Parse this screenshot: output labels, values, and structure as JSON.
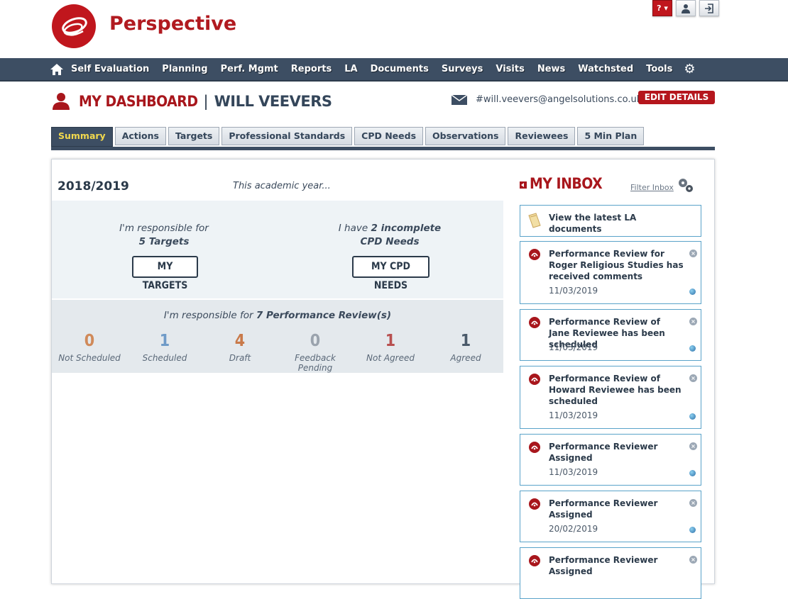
{
  "app": {
    "name": "Perspective"
  },
  "top_buttons": {
    "help": "? ▾",
    "user": "user",
    "logout": "logout"
  },
  "nav": {
    "items": [
      "Self Evaluation",
      "Planning",
      "Perf. Mgmt",
      "Reports",
      "LA",
      "Documents",
      "Surveys",
      "Visits",
      "News",
      "Watchsted",
      "Tools"
    ]
  },
  "header": {
    "title_a": "MY DASHBOARD",
    "separator": "|",
    "title_b": "WILL VEEVERS",
    "email": "#will.veevers@angelsolutions.co.uk",
    "edit_label": "EDIT DETAILS"
  },
  "tabs": [
    "Summary",
    "Actions",
    "Targets",
    "Professional Standards",
    "CPD Needs",
    "Observations",
    "Reviewees",
    "5 Min Plan"
  ],
  "summary": {
    "year": "2018/2019",
    "academic_label": "This academic year...",
    "targets_line1": "I'm responsible for",
    "targets_line2": "5 Targets",
    "targets_button": "MY TARGETS",
    "cpd_line1_a": "I have ",
    "cpd_line1_b": "2 incomplete",
    "cpd_line2": "CPD Needs",
    "cpd_button": "MY CPD NEEDS",
    "pr_head_a": "I'm responsible for ",
    "pr_head_b": "7 Performance Review(s)",
    "stats": [
      {
        "value": "0",
        "label": "Not Scheduled",
        "color": "#d08a5a"
      },
      {
        "value": "1",
        "label": "Scheduled",
        "color": "#6f9bc8"
      },
      {
        "value": "4",
        "label": "Draft",
        "color": "#c97a4a"
      },
      {
        "value": "0",
        "label": "Feedback Pending",
        "color": "#9aa3ad"
      },
      {
        "value": "1",
        "label": "Not Agreed",
        "color": "#b85050"
      },
      {
        "value": "1",
        "label": "Agreed",
        "color": "#4a5a6a"
      }
    ]
  },
  "inbox": {
    "title": "MY INBOX",
    "filter_label": "Filter Inbox",
    "messages": [
      {
        "text": "View the latest LA documents",
        "date": ""
      },
      {
        "text": "Performance Review for Roger Religious Studies has received comments",
        "date": "11/03/2019"
      },
      {
        "text": "Performance Review of Jane Reviewee has been scheduled",
        "date": "11/03/2019"
      },
      {
        "text": "Performance Review of Howard Reviewee has been scheduled",
        "date": "11/03/2019"
      },
      {
        "text": "Performance Reviewer Assigned",
        "date": "11/03/2019"
      },
      {
        "text": "Performance Reviewer Assigned",
        "date": "20/02/2019"
      },
      {
        "text": "Performance Reviewer Assigned",
        "date": ""
      }
    ]
  }
}
